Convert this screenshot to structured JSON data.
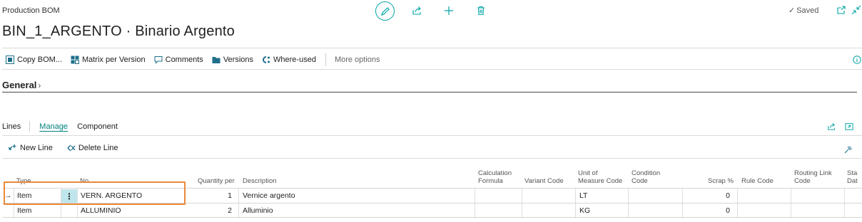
{
  "header": {
    "caption": "Production BOM",
    "title": "BIN_1_ARGENTO · Binario Argento",
    "saved_label": "Saved"
  },
  "top_icons": [
    "edit-icon",
    "share-icon",
    "add-icon",
    "delete-icon",
    "open-new-window-icon",
    "collapse-icon"
  ],
  "actions": [
    {
      "label": "Copy BOM...",
      "icon": "copy-bom-icon"
    },
    {
      "label": "Matrix per Version",
      "icon": "matrix-icon"
    },
    {
      "label": "Comments",
      "icon": "comments-icon"
    },
    {
      "label": "Versions",
      "icon": "versions-icon"
    },
    {
      "label": "Where-used",
      "icon": "where-used-icon"
    }
  ],
  "more_options": "More options",
  "general": {
    "label": "General"
  },
  "lines": {
    "title": "Lines",
    "tabs": [
      "Manage",
      "Component"
    ],
    "new_line": "New Line",
    "delete_line": "Delete Line"
  },
  "table": {
    "columns": {
      "type": "Type",
      "no": "No.",
      "qty": "Quantity per",
      "desc": "Description",
      "calc1": "Calculation",
      "calc2": "Formula",
      "variant": "Variant Code",
      "uom1": "Unit of",
      "uom2": "Measure Code",
      "cond1": "Condition",
      "cond2": "Code",
      "scrap": "Scrap %",
      "rule": "Rule Code",
      "routing1": "Routing Link",
      "routing2": "Code",
      "start1": "Sta",
      "start2": "Dat"
    },
    "rows": [
      {
        "type": "Item",
        "no": "VERN. ARGENTO",
        "qty": "1",
        "desc": "Vernice argento",
        "uom": "LT",
        "scrap": "0"
      },
      {
        "type": "Item",
        "no": "ALLUMINIO",
        "qty": "2",
        "desc": "Alluminio",
        "uom": "KG",
        "scrap": "0"
      }
    ]
  },
  "colors": {
    "accent": "#008080",
    "highlight": "#e98a3a",
    "selected_cell": "#bfe6ec"
  }
}
